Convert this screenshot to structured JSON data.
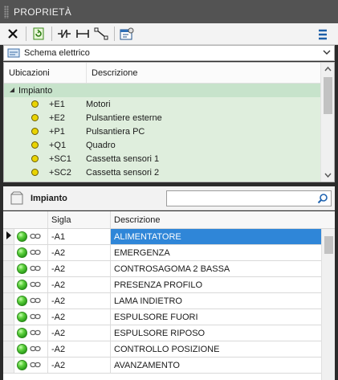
{
  "window": {
    "title": "PROPRIETÀ"
  },
  "toolbar": {
    "icons": [
      "close-x-icon",
      "refresh-icon",
      "component-icon",
      "wire-icon",
      "connection-icon",
      "properties-sheet-icon",
      "menu-icon"
    ]
  },
  "combo": {
    "selected": "Schema elettrico"
  },
  "locations": {
    "headers": {
      "ubicazioni": "Ubicazioni",
      "descrizione": "Descrizione"
    },
    "root_label": "Impianto",
    "items": [
      {
        "code": "+E1",
        "desc": "Motori"
      },
      {
        "code": "+E2",
        "desc": "Pulsantiere esterne"
      },
      {
        "code": "+P1",
        "desc": "Pulsantiera PC"
      },
      {
        "code": "+Q1",
        "desc": "Quadro"
      },
      {
        "code": "+SC1",
        "desc": "Cassetta sensori 1"
      },
      {
        "code": "+SC2",
        "desc": "Cassetta sensori 2"
      }
    ],
    "status_color": "#e9d400"
  },
  "panel": {
    "title": "Impianto",
    "search_placeholder": ""
  },
  "grid": {
    "headers": {
      "sigla": "Sigla",
      "descrizione": "Descrizione"
    },
    "rows": [
      {
        "sigla": "-A1",
        "desc": "ALIMENTATORE"
      },
      {
        "sigla": "-A2",
        "desc": "EMERGENZA"
      },
      {
        "sigla": "-A2",
        "desc": "CONTROSAGOMA 2 BASSA"
      },
      {
        "sigla": "-A2",
        "desc": "PRESENZA PROFILO"
      },
      {
        "sigla": "-A2",
        "desc": "LAMA INDIETRO"
      },
      {
        "sigla": "-A2",
        "desc": "ESPULSORE FUORI"
      },
      {
        "sigla": "-A2",
        "desc": "ESPULSORE RIPOSO"
      },
      {
        "sigla": "-A2",
        "desc": "CONTROLLO POSIZIONE"
      },
      {
        "sigla": "-A2",
        "desc": "AVANZAMENTO"
      }
    ],
    "selected_color": "#2f86d8"
  }
}
